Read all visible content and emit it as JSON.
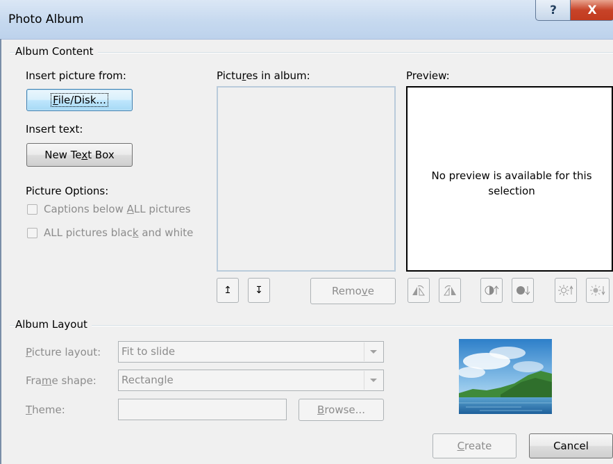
{
  "window": {
    "title": "Photo Album",
    "help_glyph": "?",
    "close_glyph": "X"
  },
  "album_content": {
    "group_label": "Album Content",
    "insert_picture_label": "Insert picture from:",
    "file_disk_button": {
      "pre": "",
      "accel": "F",
      "post": "ile/Disk..."
    },
    "insert_text_label": "Insert text:",
    "new_text_box_button": {
      "pre": "New Te",
      "accel": "x",
      "post": "t Box"
    },
    "picture_options_label": "Picture Options:",
    "captions_checkbox": {
      "pre": "Captions below ",
      "accel": "A",
      "post": "LL pictures",
      "checked": false
    },
    "bw_checkbox": {
      "pre": "ALL pictures blac",
      "accel": "k",
      "post": " and white",
      "checked": false
    },
    "pictures_in_album_label": {
      "pre": "Pictu",
      "accel": "r",
      "post": "es in album:"
    },
    "preview_label": "Preview:",
    "preview_message": "No preview is available for this selection",
    "move_up_glyph": "↥",
    "move_down_glyph": "↧",
    "remove_button": {
      "pre": "Remo",
      "accel": "v",
      "post": "e"
    }
  },
  "album_layout": {
    "group_label": "Album Layout",
    "picture_layout": {
      "pre": "",
      "accel": "P",
      "post": "icture layout:",
      "value": "Fit to slide"
    },
    "frame_shape": {
      "pre": "Fra",
      "accel": "m",
      "post": "e shape:",
      "value": "Rectangle"
    },
    "theme": {
      "pre": "",
      "accel": "T",
      "post": "heme:",
      "value": ""
    },
    "browse_button": {
      "pre": "",
      "accel": "B",
      "post": "rowse..."
    }
  },
  "footer": {
    "create_button": {
      "pre": "",
      "accel": "C",
      "post": "reate"
    },
    "cancel_button": "Cancel"
  },
  "colors": {
    "accent": "#3c7fb1",
    "disabled_text": "#8c8c8c",
    "title_bar": "#c6d9ef",
    "close_red": "#c74328"
  }
}
